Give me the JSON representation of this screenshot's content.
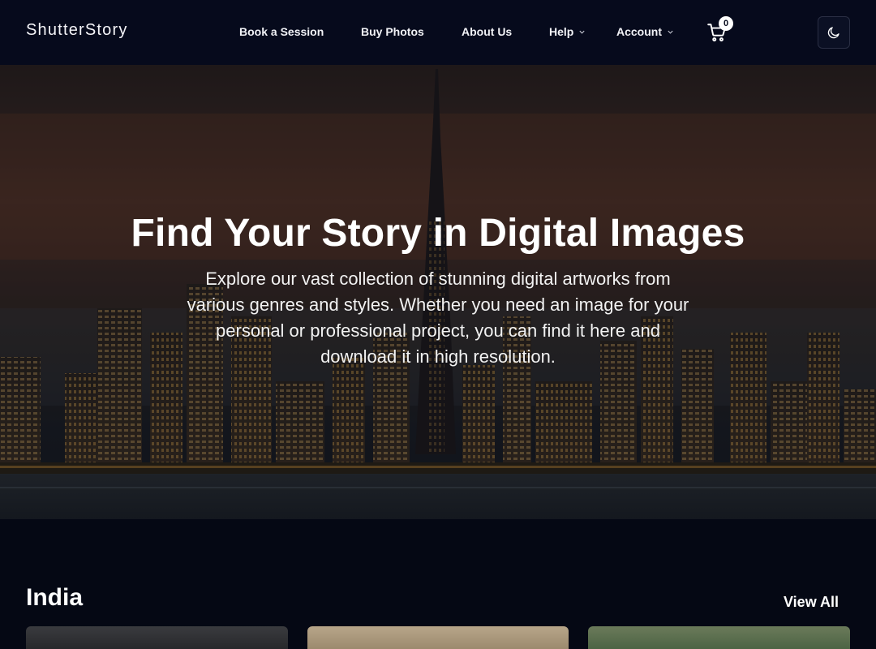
{
  "nav": {
    "brand": "ShutterStory",
    "items": [
      {
        "label": "Book a Session"
      },
      {
        "label": "Buy Photos"
      },
      {
        "label": "About Us"
      },
      {
        "label": "Help"
      },
      {
        "label": "Account"
      }
    ],
    "cart_count": "0",
    "icons": {
      "cart": "cart-icon",
      "theme": "moon-icon",
      "dropdown": "chevron-down-icon"
    }
  },
  "hero": {
    "title": "Find Your Story in Digital Images",
    "subtitle": "Explore our vast collection of stunning digital artworks from various genres and styles. Whether you need an image for your personal or professional project, you can find it here and download it in high resolution."
  },
  "section": {
    "title": "India",
    "view_all": "View All"
  },
  "colors": {
    "background": "#050814",
    "navbar": "#060a1c",
    "text": "#ffffff"
  }
}
